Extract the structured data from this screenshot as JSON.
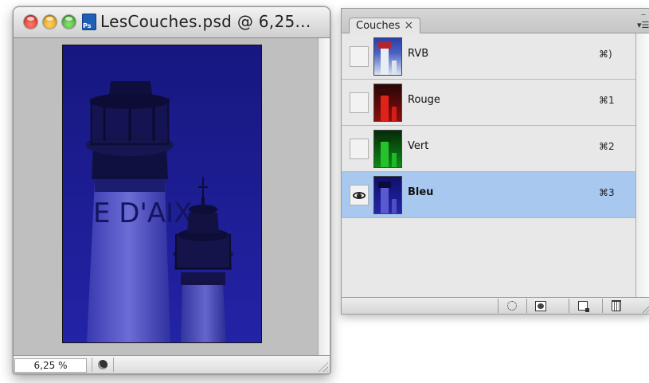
{
  "document_window": {
    "title": "LesCouches.psd @ 6,25...",
    "app_icon_label": "Ps",
    "zoom_level": "6,25 %",
    "image_text": "E D'AIX"
  },
  "panel": {
    "tab_label": "Couches",
    "tab_close_glyph": "×",
    "minimize_glyph": "–",
    "menu_glyph": "▾☰",
    "channels": [
      {
        "name": "RVB",
        "shortcut": "⌘)",
        "visible": false,
        "selected": false,
        "thumb_color": "#cfd8e6"
      },
      {
        "name": "Rouge",
        "shortcut": "⌘1",
        "visible": false,
        "selected": false,
        "thumb_color": "#d01a12"
      },
      {
        "name": "Vert",
        "shortcut": "⌘2",
        "visible": false,
        "selected": false,
        "thumb_color": "#22b32a"
      },
      {
        "name": "Bleu",
        "shortcut": "⌘3",
        "visible": true,
        "selected": true,
        "thumb_color": "#2a2ad0"
      }
    ],
    "footer_buttons": [
      {
        "icon": "load-selection-icon"
      },
      {
        "icon": "save-selection-icon"
      },
      {
        "icon": "new-channel-icon"
      },
      {
        "icon": "trash-icon"
      }
    ]
  },
  "colors": {
    "selected_row": "#a8c8f0",
    "image_blue": "#1c1c92"
  }
}
